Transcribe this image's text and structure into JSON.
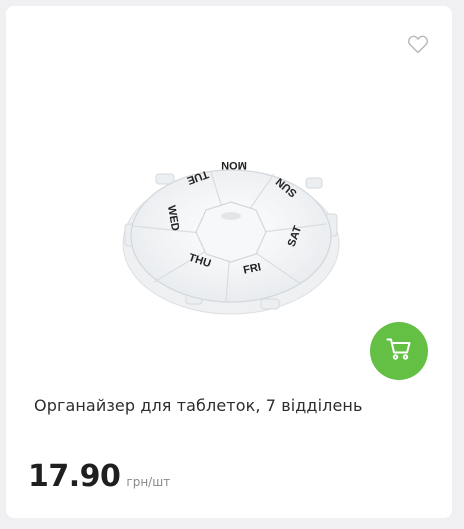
{
  "product": {
    "title": "Органайзер для таблеток, 7 відділень",
    "price": "17.90",
    "unit": "грн/шт",
    "day_labels": [
      "MON",
      "SUN",
      "SAT",
      "FRI",
      "THU",
      "WED",
      "TUE"
    ]
  },
  "icons": {
    "favorite": "heart-outline-icon",
    "cart": "shopping-cart-icon"
  },
  "colors": {
    "accent": "#64bf45",
    "background": "#f0f0f2",
    "card": "#ffffff"
  }
}
